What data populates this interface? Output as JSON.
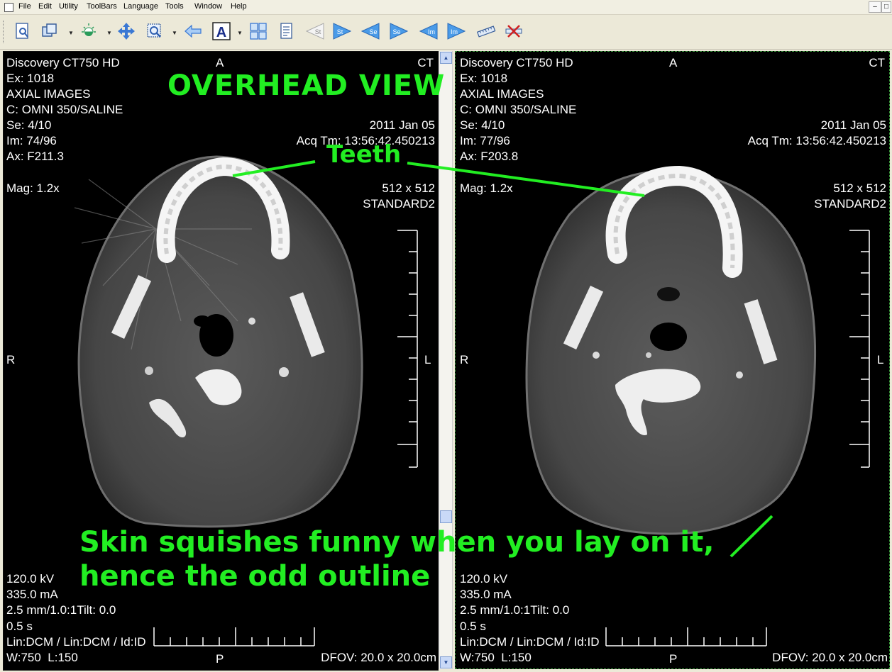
{
  "menu": [
    "File",
    "Edit",
    "Utility",
    "ToolBars",
    "Language",
    "Tools",
    "Window",
    "Help"
  ],
  "toolbar": {
    "buttons": [
      {
        "name": "open-image-icon"
      },
      {
        "name": "layout-icon"
      },
      {
        "name": "window-level-icon"
      },
      {
        "name": "pan-icon"
      },
      {
        "name": "zoom-icon"
      },
      {
        "name": "back-arrow-icon"
      },
      {
        "name": "annotation-text-icon",
        "label": "A"
      },
      {
        "name": "grid-layout-icon"
      },
      {
        "name": "report-icon"
      },
      {
        "name": "first-study-icon",
        "label": "St"
      },
      {
        "name": "next-study-icon",
        "label": "St"
      },
      {
        "name": "prev-series-icon",
        "label": "Se"
      },
      {
        "name": "next-series-icon",
        "label": "Se"
      },
      {
        "name": "prev-image-icon",
        "label": "Im"
      },
      {
        "name": "next-image-icon",
        "label": "Im"
      },
      {
        "name": "ruler-measure-icon"
      },
      {
        "name": "delete-measure-icon"
      }
    ]
  },
  "left_view": {
    "scanner": "Discovery CT750 HD",
    "exam": "Ex: 1018",
    "description": "AXIAL IMAGES",
    "contrast": "C: OMNI 350/SALINE",
    "series": "Se: 4/10",
    "image": "Im: 74/96",
    "axial": "Ax: F211.3",
    "mag": "Mag: 1.2x",
    "top_marker": "A",
    "modality": "CT",
    "date": "2011 Jan 05",
    "acq_time": "Acq Tm: 13:56:42.450213",
    "matrix": "512 x 512",
    "kernel": "STANDARD2",
    "left_marker": "R",
    "right_marker": "L",
    "kv": "120.0 kV",
    "ma": "335.0 mA",
    "thickness": "2.5 mm/1.0:1Tilt: 0.0",
    "time": "0.5 s",
    "lin": "Lin:DCM / Lin:DCM / Id:ID",
    "window_level": "W:750  L:150",
    "bottom_marker": "P",
    "dfov": "DFOV: 20.0 x 20.0cm"
  },
  "right_view": {
    "scanner": "Discovery CT750 HD",
    "exam": "Ex: 1018",
    "description": "AXIAL IMAGES",
    "contrast": "C: OMNI 350/SALINE",
    "series": "Se: 4/10",
    "image": "Im: 77/96",
    "axial": "Ax: F203.8",
    "mag": "Mag: 1.2x",
    "top_marker": "A",
    "modality": "CT",
    "date": "2011 Jan 05",
    "acq_time": "Acq Tm: 13:56:42.450213",
    "matrix": "512 x 512",
    "kernel": "STANDARD2",
    "left_marker": "R",
    "right_marker": "L",
    "kv": "120.0 kV",
    "ma": "335.0 mA",
    "thickness": "2.5 mm/1.0:1Tilt: 0.0",
    "time": "0.5 s",
    "lin": "Lin:DCM / Lin:DCM / Id:ID",
    "window_level": "W:750  L:150",
    "bottom_marker": "P",
    "dfov": "DFOV: 20.0 x 20.0cm"
  },
  "annotations": {
    "title": "OVERHEAD VIEW",
    "teeth": "Teeth",
    "skin_line1": "Skin squishes funny when you lay on it,",
    "skin_line2": "hence the odd outline",
    "color": "#22ee22"
  }
}
